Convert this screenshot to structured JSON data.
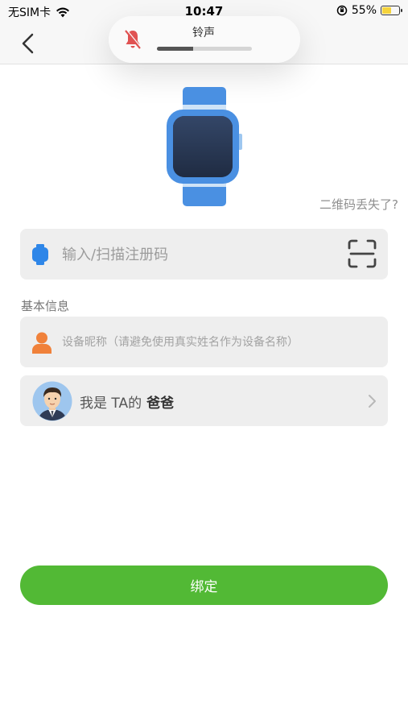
{
  "status_bar": {
    "carrier": "无SIM卡",
    "time": "10:47",
    "battery": "55%",
    "battery_level": 0.55
  },
  "ringer": {
    "label": "铃声",
    "level": 0.38
  },
  "links": {
    "lost_qr": "二维码丢失了?"
  },
  "register": {
    "placeholder": "输入/扫描注册码",
    "value": ""
  },
  "basic_info": {
    "label": "基本信息",
    "nickname_placeholder": "设备昵称（请避免使用真实姓名作为设备名称）",
    "nickname_value": ""
  },
  "relation": {
    "prefix": "我是 TA的",
    "value": "爸爸"
  },
  "actions": {
    "bind_label": "绑定"
  },
  "colors": {
    "accent_green": "#52b935",
    "watch_blue": "#4a90e2",
    "person_orange": "#f0813a",
    "mute_red": "#e05252"
  }
}
